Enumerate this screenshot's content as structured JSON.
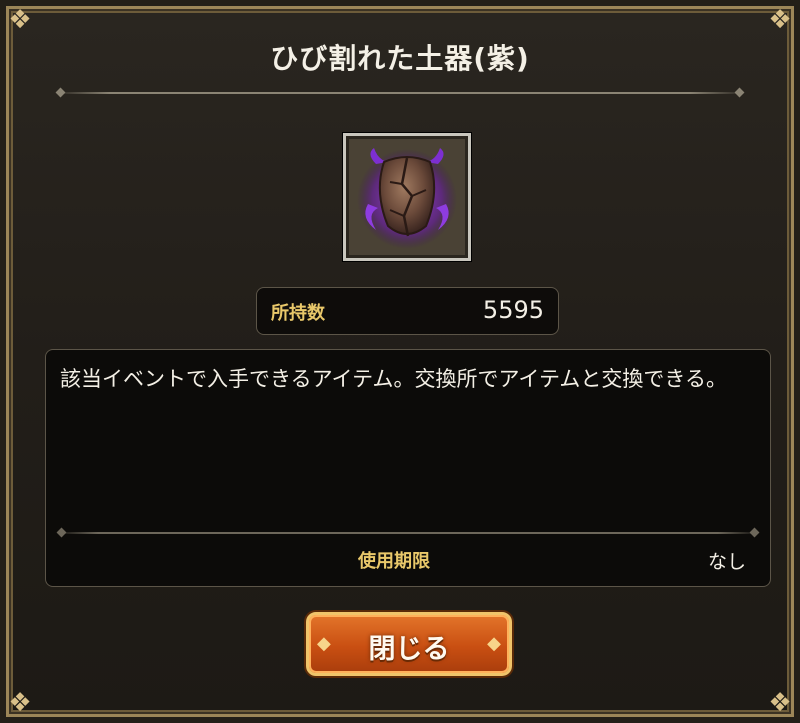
{
  "dialog": {
    "title": "ひび割れた土器(紫)",
    "count_label": "所持数",
    "count_value": "5595",
    "description": "該当イベントで入手できるアイテム。交換所でアイテムと交換できる。",
    "expiry_label": "使用期限",
    "expiry_value": "なし",
    "close_label": "閉じる",
    "item_icon": "cracked-pottery-purple-icon"
  },
  "colors": {
    "accent_gold": "#e9c86a",
    "button_orange": "#c94f12",
    "item_glow_purple": "#8a2be2"
  }
}
